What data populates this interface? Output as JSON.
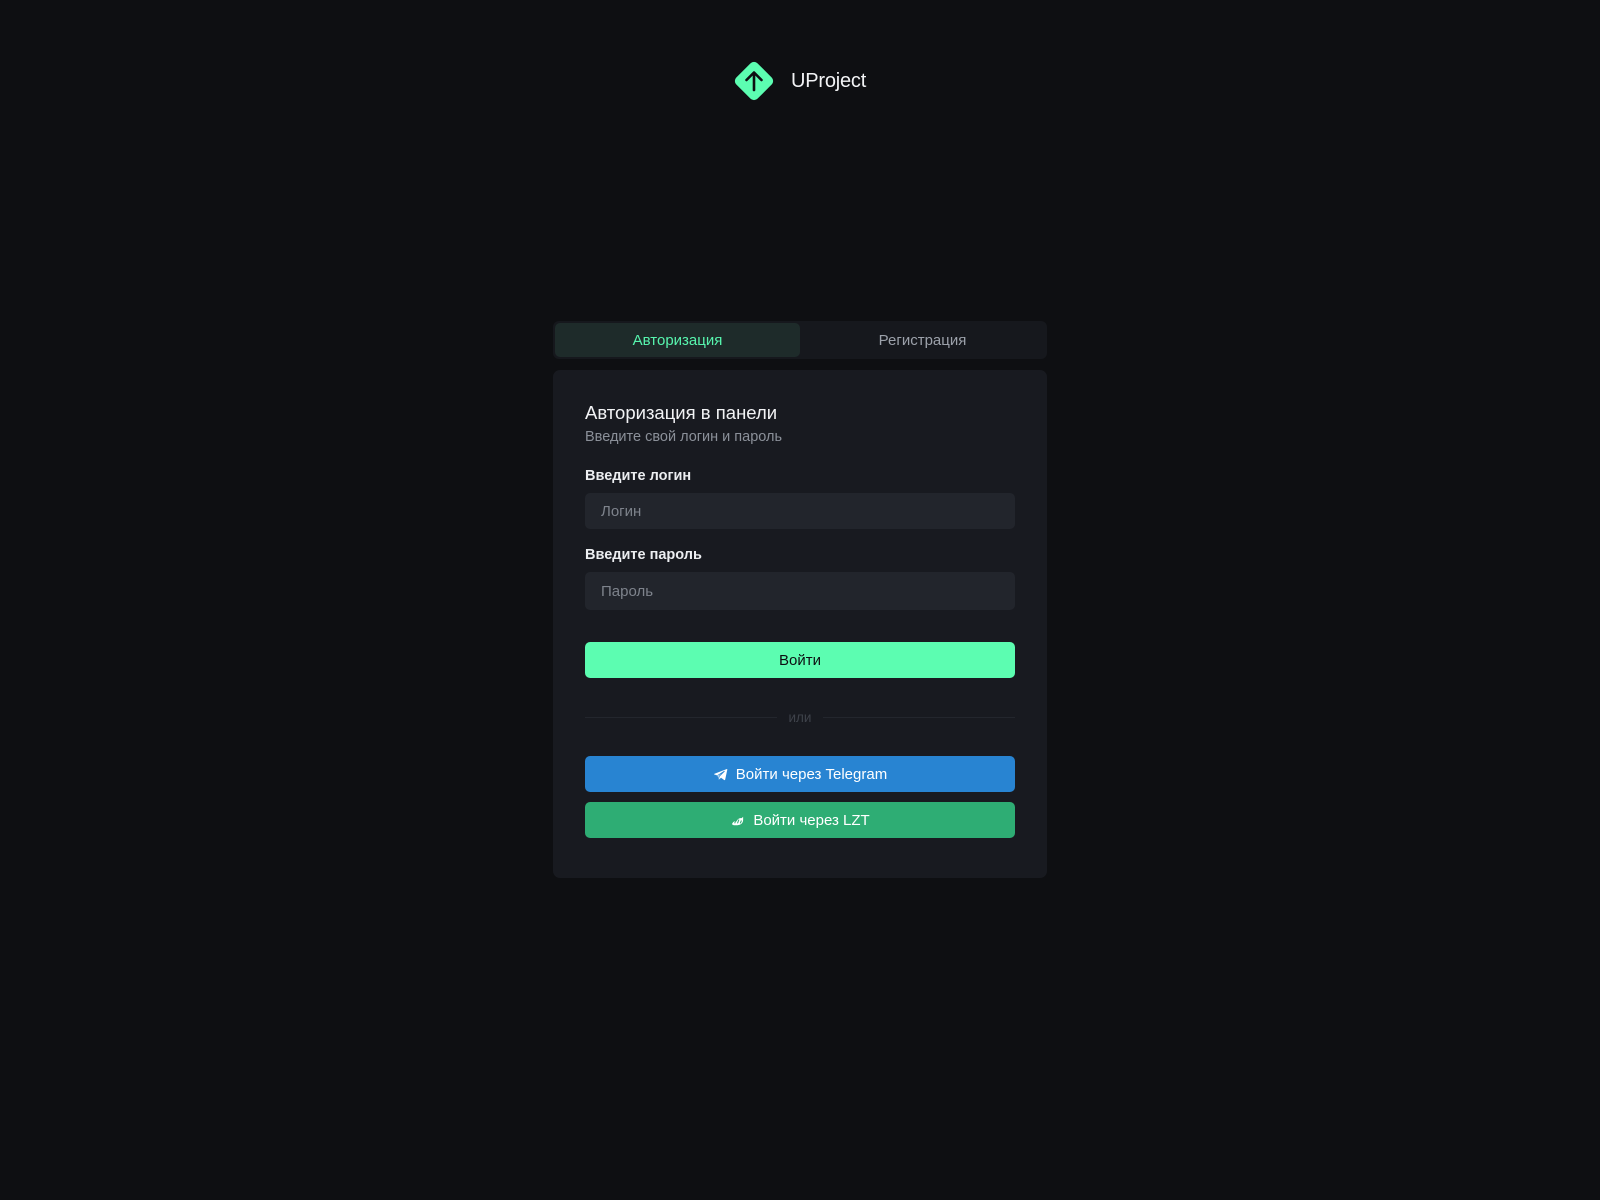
{
  "brand": {
    "name": "UProject",
    "accent_color": "#5cfdb1",
    "logo_icon": "arrow-up-diamond-icon"
  },
  "tabs": [
    {
      "label": "Авторизация",
      "active": true
    },
    {
      "label": "Регистрация",
      "active": false
    }
  ],
  "form": {
    "title": "Авторизация в панели",
    "subtitle": "Введите свой логин и пароль",
    "login": {
      "label": "Введите логин",
      "placeholder": "Логин",
      "value": ""
    },
    "password": {
      "label": "Введите пароль",
      "placeholder": "Пароль",
      "value": ""
    },
    "submit_label": "Войти",
    "divider_text": "или"
  },
  "social": {
    "telegram": {
      "label": "Войти через Telegram",
      "icon": "telegram-icon",
      "color": "#2884d2"
    },
    "lzt": {
      "label": "Войти через LZT",
      "icon": "lzt-icon",
      "color": "#2ead74"
    }
  }
}
